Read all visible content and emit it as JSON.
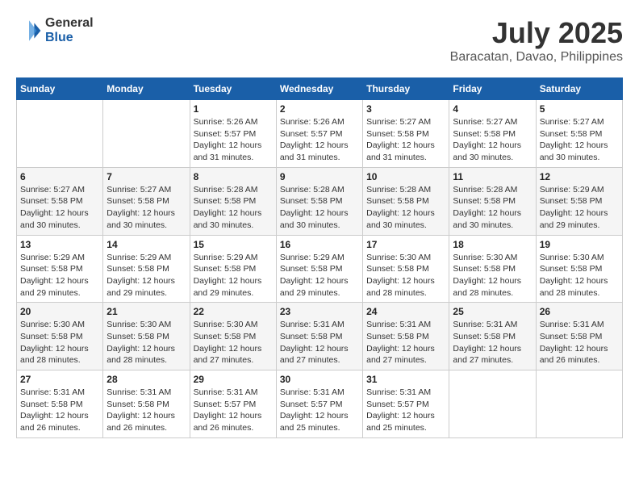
{
  "header": {
    "logo_general": "General",
    "logo_blue": "Blue",
    "month": "July 2025",
    "location": "Baracatan, Davao, Philippines"
  },
  "weekdays": [
    "Sunday",
    "Monday",
    "Tuesday",
    "Wednesday",
    "Thursday",
    "Friday",
    "Saturday"
  ],
  "weeks": [
    [
      {
        "day": "",
        "info": ""
      },
      {
        "day": "",
        "info": ""
      },
      {
        "day": "1",
        "info": "Sunrise: 5:26 AM\nSunset: 5:57 PM\nDaylight: 12 hours and 31 minutes."
      },
      {
        "day": "2",
        "info": "Sunrise: 5:26 AM\nSunset: 5:57 PM\nDaylight: 12 hours and 31 minutes."
      },
      {
        "day": "3",
        "info": "Sunrise: 5:27 AM\nSunset: 5:58 PM\nDaylight: 12 hours and 31 minutes."
      },
      {
        "day": "4",
        "info": "Sunrise: 5:27 AM\nSunset: 5:58 PM\nDaylight: 12 hours and 30 minutes."
      },
      {
        "day": "5",
        "info": "Sunrise: 5:27 AM\nSunset: 5:58 PM\nDaylight: 12 hours and 30 minutes."
      }
    ],
    [
      {
        "day": "6",
        "info": "Sunrise: 5:27 AM\nSunset: 5:58 PM\nDaylight: 12 hours and 30 minutes."
      },
      {
        "day": "7",
        "info": "Sunrise: 5:27 AM\nSunset: 5:58 PM\nDaylight: 12 hours and 30 minutes."
      },
      {
        "day": "8",
        "info": "Sunrise: 5:28 AM\nSunset: 5:58 PM\nDaylight: 12 hours and 30 minutes."
      },
      {
        "day": "9",
        "info": "Sunrise: 5:28 AM\nSunset: 5:58 PM\nDaylight: 12 hours and 30 minutes."
      },
      {
        "day": "10",
        "info": "Sunrise: 5:28 AM\nSunset: 5:58 PM\nDaylight: 12 hours and 30 minutes."
      },
      {
        "day": "11",
        "info": "Sunrise: 5:28 AM\nSunset: 5:58 PM\nDaylight: 12 hours and 30 minutes."
      },
      {
        "day": "12",
        "info": "Sunrise: 5:29 AM\nSunset: 5:58 PM\nDaylight: 12 hours and 29 minutes."
      }
    ],
    [
      {
        "day": "13",
        "info": "Sunrise: 5:29 AM\nSunset: 5:58 PM\nDaylight: 12 hours and 29 minutes."
      },
      {
        "day": "14",
        "info": "Sunrise: 5:29 AM\nSunset: 5:58 PM\nDaylight: 12 hours and 29 minutes."
      },
      {
        "day": "15",
        "info": "Sunrise: 5:29 AM\nSunset: 5:58 PM\nDaylight: 12 hours and 29 minutes."
      },
      {
        "day": "16",
        "info": "Sunrise: 5:29 AM\nSunset: 5:58 PM\nDaylight: 12 hours and 29 minutes."
      },
      {
        "day": "17",
        "info": "Sunrise: 5:30 AM\nSunset: 5:58 PM\nDaylight: 12 hours and 28 minutes."
      },
      {
        "day": "18",
        "info": "Sunrise: 5:30 AM\nSunset: 5:58 PM\nDaylight: 12 hours and 28 minutes."
      },
      {
        "day": "19",
        "info": "Sunrise: 5:30 AM\nSunset: 5:58 PM\nDaylight: 12 hours and 28 minutes."
      }
    ],
    [
      {
        "day": "20",
        "info": "Sunrise: 5:30 AM\nSunset: 5:58 PM\nDaylight: 12 hours and 28 minutes."
      },
      {
        "day": "21",
        "info": "Sunrise: 5:30 AM\nSunset: 5:58 PM\nDaylight: 12 hours and 28 minutes."
      },
      {
        "day": "22",
        "info": "Sunrise: 5:30 AM\nSunset: 5:58 PM\nDaylight: 12 hours and 27 minutes."
      },
      {
        "day": "23",
        "info": "Sunrise: 5:31 AM\nSunset: 5:58 PM\nDaylight: 12 hours and 27 minutes."
      },
      {
        "day": "24",
        "info": "Sunrise: 5:31 AM\nSunset: 5:58 PM\nDaylight: 12 hours and 27 minutes."
      },
      {
        "day": "25",
        "info": "Sunrise: 5:31 AM\nSunset: 5:58 PM\nDaylight: 12 hours and 27 minutes."
      },
      {
        "day": "26",
        "info": "Sunrise: 5:31 AM\nSunset: 5:58 PM\nDaylight: 12 hours and 26 minutes."
      }
    ],
    [
      {
        "day": "27",
        "info": "Sunrise: 5:31 AM\nSunset: 5:58 PM\nDaylight: 12 hours and 26 minutes."
      },
      {
        "day": "28",
        "info": "Sunrise: 5:31 AM\nSunset: 5:58 PM\nDaylight: 12 hours and 26 minutes."
      },
      {
        "day": "29",
        "info": "Sunrise: 5:31 AM\nSunset: 5:57 PM\nDaylight: 12 hours and 26 minutes."
      },
      {
        "day": "30",
        "info": "Sunrise: 5:31 AM\nSunset: 5:57 PM\nDaylight: 12 hours and 25 minutes."
      },
      {
        "day": "31",
        "info": "Sunrise: 5:31 AM\nSunset: 5:57 PM\nDaylight: 12 hours and 25 minutes."
      },
      {
        "day": "",
        "info": ""
      },
      {
        "day": "",
        "info": ""
      }
    ]
  ]
}
